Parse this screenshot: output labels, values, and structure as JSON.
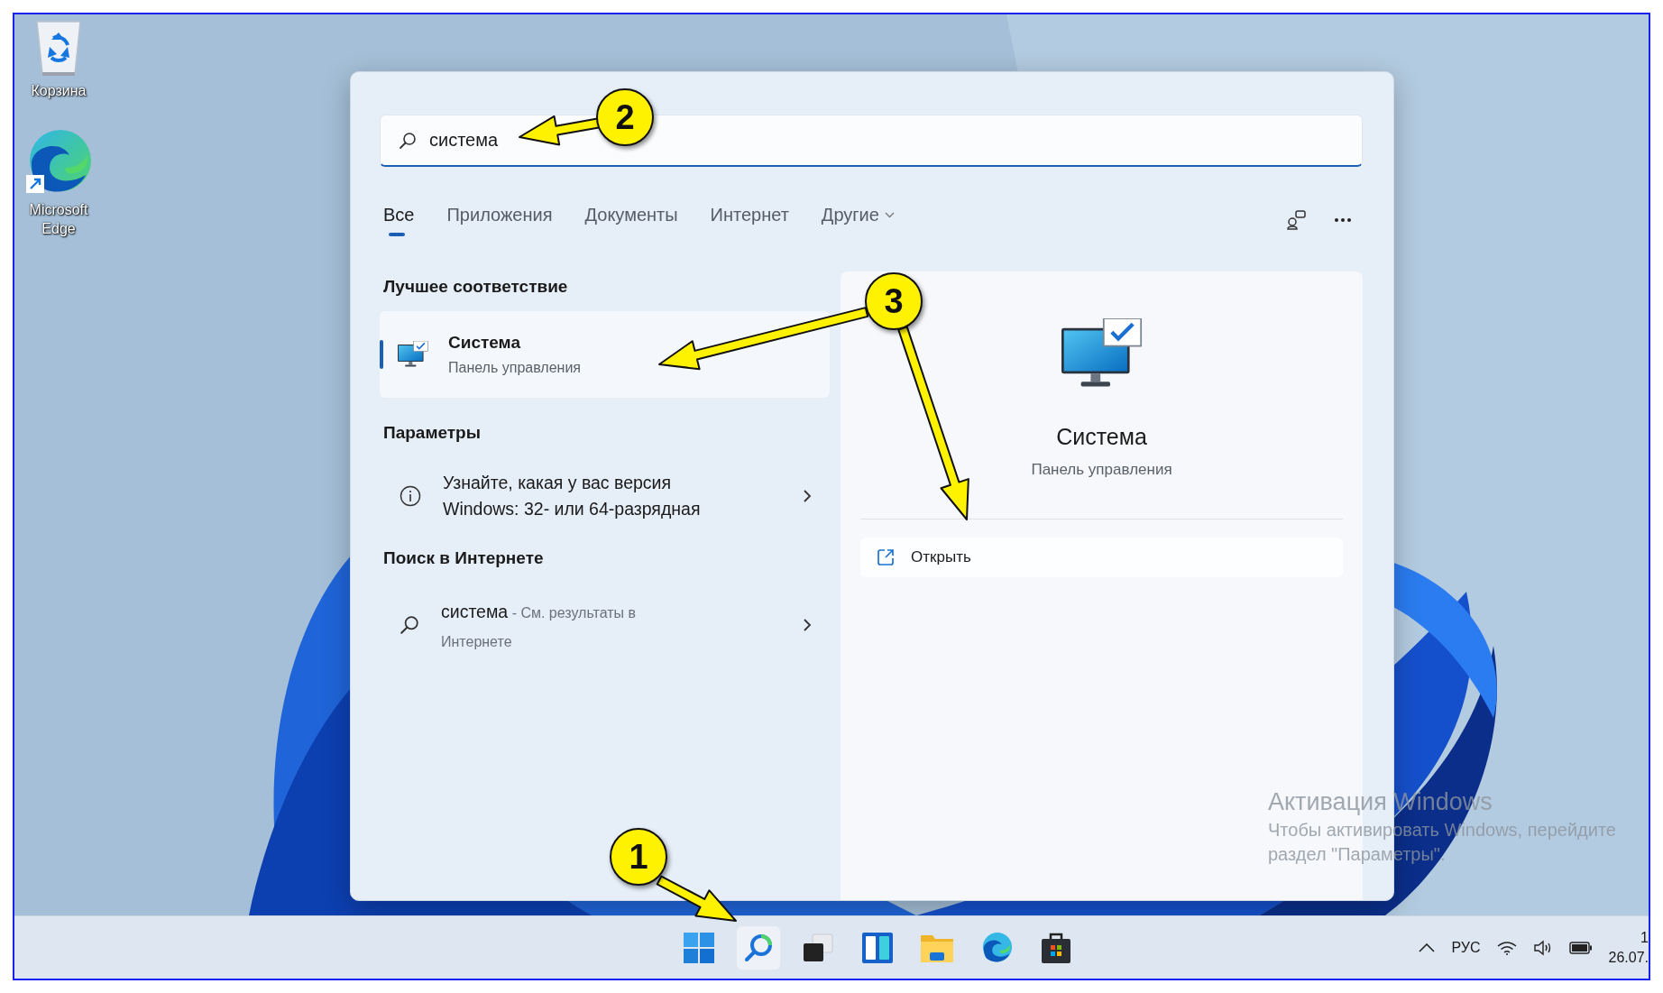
{
  "desktop_icons": [
    {
      "label": "Корзина",
      "kind": "recycle-bin"
    },
    {
      "label": "Microsoft Edge",
      "kind": "edge",
      "shortcut": true
    }
  ],
  "search": {
    "value": "система"
  },
  "tabs": [
    {
      "label": "Все",
      "selected": true,
      "has_menu": false
    },
    {
      "label": "Приложения",
      "selected": false,
      "has_menu": false
    },
    {
      "label": "Документы",
      "selected": false,
      "has_menu": false
    },
    {
      "label": "Интернет",
      "selected": false,
      "has_menu": false
    },
    {
      "label": "Другие",
      "selected": false,
      "has_menu": true
    }
  ],
  "best_match": {
    "heading": "Лучшее соответствие",
    "title": "Система",
    "subtitle": "Панель управления",
    "selected": true
  },
  "settings": {
    "heading": "Параметры",
    "items": [
      {
        "text": "Узнайте, какая у вас версия Windows: 32- или 64-разрядная"
      }
    ]
  },
  "web": {
    "heading": "Поиск в Интернете",
    "items": [
      {
        "query": "система",
        "hint": " - См. результаты в Интернете"
      }
    ]
  },
  "preview": {
    "title": "Система",
    "subtitle": "Панель управления",
    "actions": [
      {
        "label": "Открыть"
      }
    ]
  },
  "activation": {
    "title": "Активация Windows",
    "lines": [
      "Чтобы активировать Windows, перейдите",
      "раздел \"Параметры\"."
    ]
  },
  "taskbar": {
    "apps": [
      {
        "kind": "start",
        "active": false
      },
      {
        "kind": "search",
        "active": true
      },
      {
        "kind": "task-view",
        "active": false
      },
      {
        "kind": "widgets",
        "active": false
      },
      {
        "kind": "explorer",
        "active": false
      },
      {
        "kind": "edge",
        "active": false
      },
      {
        "kind": "store",
        "active": false
      }
    ],
    "tray": {
      "language": "РУС",
      "time": "1",
      "date": "26.07."
    }
  },
  "annotations": [
    {
      "label": "2"
    },
    {
      "label": "3"
    },
    {
      "label": "1"
    }
  ]
}
